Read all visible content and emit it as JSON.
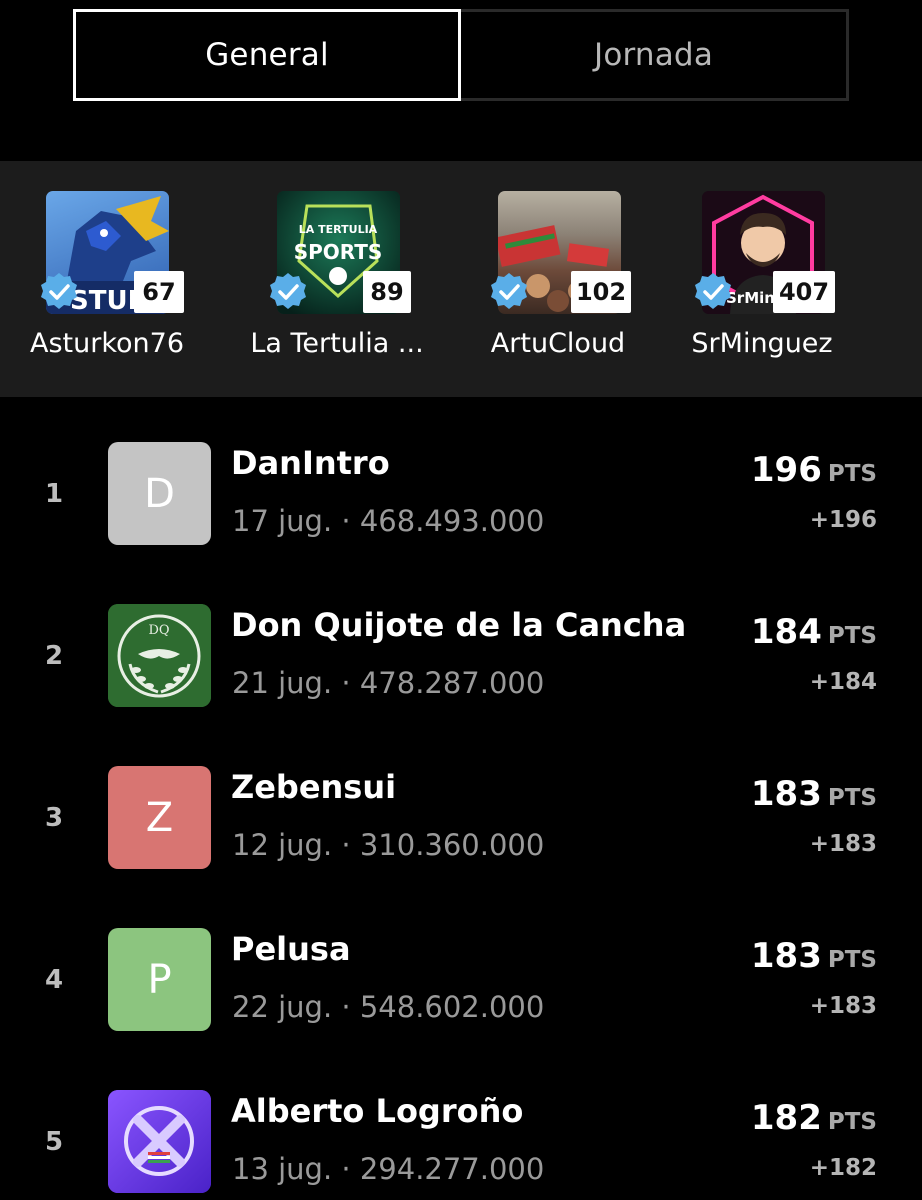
{
  "tabs": [
    {
      "label": "General",
      "active": true
    },
    {
      "label": "Jornada",
      "active": false
    }
  ],
  "featured": [
    {
      "name": "Asturkon76",
      "count": "67",
      "thumb_text": "STURK",
      "icon": "horse-logo"
    },
    {
      "name": "La Tertulia ...",
      "count": "89",
      "thumb_text_top": "LA TERTULIA",
      "thumb_text": "SPORTS",
      "icon": "football-logo"
    },
    {
      "name": "ArtuCloud",
      "count": "102",
      "icon": "stadium-crowd-photo"
    },
    {
      "name": "SrMinguez",
      "count": "407",
      "thumb_text": "SrMing",
      "icon": "cartoon-avatar"
    }
  ],
  "ranking": [
    {
      "rank": "1",
      "initial": "D",
      "avatar_color": "#c4c4c4",
      "name": "DanIntro",
      "sub": "17 jug. · 468.493.000",
      "points": "196",
      "unit": "PTS",
      "delta": "+196"
    },
    {
      "rank": "2",
      "initial": "",
      "avatar_color": "#2f6b2f",
      "avatar_text": "DQ",
      "name": "Don Quijote de la Cancha",
      "sub": "21 jug. · 478.287.000",
      "points": "184",
      "unit": "PTS",
      "delta": "+184"
    },
    {
      "rank": "3",
      "initial": "Z",
      "avatar_color": "#d87572",
      "name": "Zebensui",
      "sub": "12 jug. · 310.360.000",
      "points": "183",
      "unit": "PTS",
      "delta": "+183"
    },
    {
      "rank": "4",
      "initial": "P",
      "avatar_color": "#8cc57f",
      "name": "Pelusa",
      "sub": "22 jug. · 548.602.000",
      "points": "183",
      "unit": "PTS",
      "delta": "+183"
    },
    {
      "rank": "5",
      "initial": "",
      "avatar_color": "#6a3fe0",
      "name": "Alberto Logroño",
      "sub": "13 jug. · 294.277.000",
      "points": "182",
      "unit": "PTS",
      "delta": "+182"
    }
  ]
}
